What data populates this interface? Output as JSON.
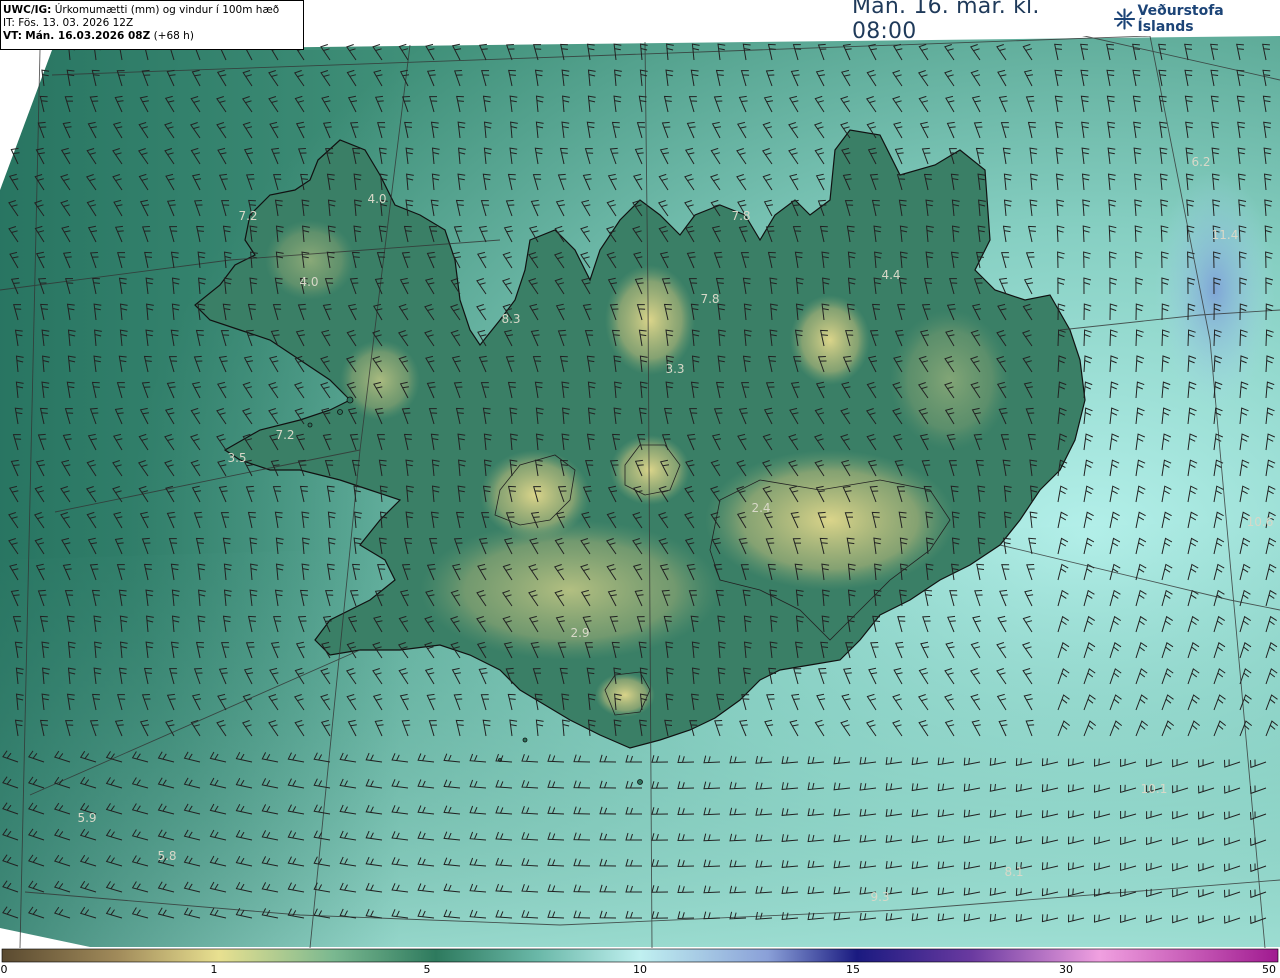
{
  "header": {
    "model_label": "UWC/IG:",
    "parameter": "Úrkomumætti (mm) og vindur í 100m hæð",
    "initial_time": "IT: Fös. 13. 03. 2026 12Z",
    "valid_label": "VT:",
    "valid_time": "Mán. 16.03.2026 08Z",
    "lead": "(+68 h)"
  },
  "title": {
    "text": "Mán. 16. mar. kl. 08:00",
    "logo_text": "Veðurstofa Íslands",
    "logo_icon": "snowflake-logo-icon"
  },
  "map_labels": [
    {
      "id": "w-fjords-nw",
      "text": "7.2"
    },
    {
      "id": "hornstrandir",
      "text": "4.0"
    },
    {
      "id": "w-fjords-c",
      "text": "4.0"
    },
    {
      "id": "skagi",
      "text": "8.3"
    },
    {
      "id": "trollaskagi",
      "text": "7.8"
    },
    {
      "id": "eyjafjordur",
      "text": "7.8"
    },
    {
      "id": "northeast",
      "text": "4.4"
    },
    {
      "id": "ne-sea",
      "text": "6.2"
    },
    {
      "id": "ne-sea-2",
      "text": "11.4"
    },
    {
      "id": "north-central",
      "text": "3.3"
    },
    {
      "id": "snaefellsnes",
      "text": "7.2"
    },
    {
      "id": "snaefellsnes-tip",
      "text": "3.5"
    },
    {
      "id": "east-sea",
      "text": "10.6"
    },
    {
      "id": "central",
      "text": "2.4"
    },
    {
      "id": "south-central",
      "text": "2.9"
    },
    {
      "id": "sw-sea-1",
      "text": "5.9"
    },
    {
      "id": "sw-sea-2",
      "text": "5.8"
    },
    {
      "id": "se-sea-1",
      "text": "10.1"
    },
    {
      "id": "se-sea-2",
      "text": "8.1"
    },
    {
      "id": "s-sea",
      "text": "9.3"
    }
  ],
  "colorbar": {
    "ticks": [
      "0",
      "1",
      "5",
      "10",
      "15",
      "30",
      "50"
    ],
    "colors": [
      "#5a4a30",
      "#a08a5a",
      "#e8e090",
      "#2e7a5e",
      "#5aa898",
      "#c0f0f0",
      "#8aa0d8",
      "#1a1a80",
      "#8a3aa0",
      "#f0a0e0",
      "#a01a90"
    ]
  },
  "colors": {
    "land_low": "#2f735c",
    "land_mid": "#4f9174",
    "land_high": "#d8d084",
    "sea_north": "#4f9a88",
    "sea_east": "#a9ece6",
    "sea_south": "#7ec4b8",
    "barb": "#222222",
    "coast": "#111111",
    "grid": "#333333"
  }
}
